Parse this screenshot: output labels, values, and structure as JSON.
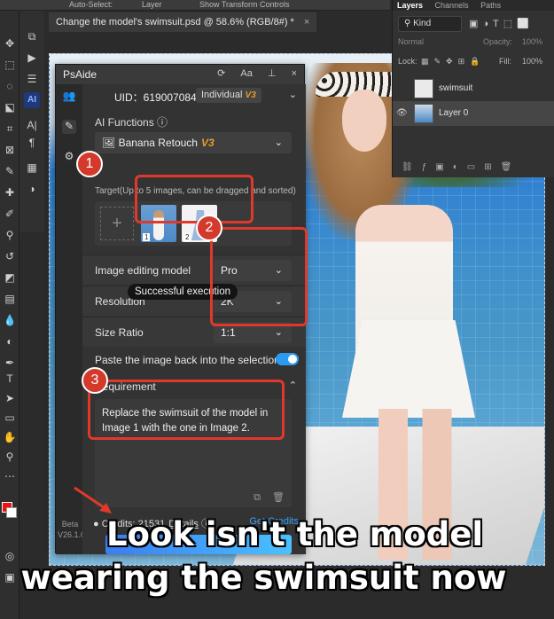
{
  "options_bar": {
    "auto_select": "Auto-Select:",
    "layer_select": "Layer",
    "transform": "Show Transform Controls"
  },
  "doc_tab": {
    "title": "Change the model's swimsuit.psd @ 58.6% (RGB/8#) *",
    "close": "×"
  },
  "layers_panel": {
    "tabs": [
      "Layers",
      "Channels",
      "Paths"
    ],
    "kind": "Kind",
    "blend_mode": "Normal",
    "opacity_label": "Opacity:",
    "opacity_value": "100%",
    "lock_label": "Lock:",
    "fill_label": "Fill:",
    "fill_value": "100%",
    "layers": [
      {
        "name": "swimsuit"
      },
      {
        "name": "Layer 0"
      }
    ]
  },
  "psaide": {
    "title": "PsAide",
    "title_icons": {
      "refresh": "⟳",
      "font": "Aa",
      "pin": "⊥",
      "close": "×"
    },
    "uid": "UID：619007084",
    "plan": "Individual",
    "plan_tag": "V3",
    "ai_functions_label": "AI Functions",
    "ai_function_value": "Banana Retouch",
    "ai_function_tag": "V3",
    "target_label": "Target(Up to 5 images, can be dragged and sorted)",
    "thumbnails": [
      {
        "label": "1"
      },
      {
        "label": "2"
      }
    ],
    "fields": [
      {
        "label": "Image editing model",
        "value": "Pro"
      },
      {
        "label": "Resolution",
        "value": "2K"
      },
      {
        "label": "Size Ratio",
        "value": "1:1"
      }
    ],
    "paste_back_label": "Paste the image back into the selection",
    "paste_back_on": true,
    "requirement_label": "Requirement",
    "requirement_text": "Replace the swimsuit of the model in Image 1 with the one in Image 2.",
    "credits_label": "Credits: 21531",
    "details_label": "Details",
    "get_credits": "Get Credits",
    "beta_label": "Beta",
    "version": "V26.1.0",
    "tooltip": "Successful execution"
  },
  "annotations": {
    "marker1": "1",
    "marker2": "2",
    "marker3": "3",
    "accent": "#e0392b"
  },
  "caption": {
    "line1": "Look isn't the model",
    "line2": "wearing the swimsuit now"
  }
}
